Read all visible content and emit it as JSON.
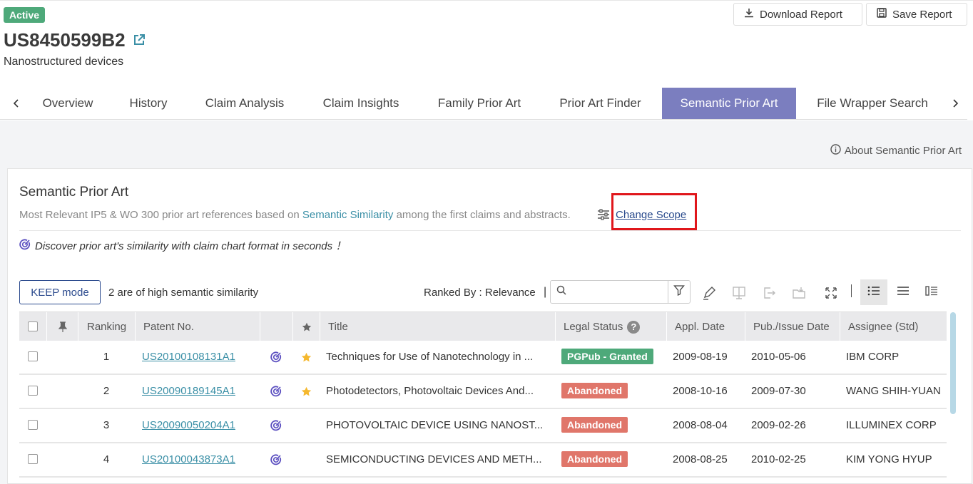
{
  "header": {
    "status": "Active",
    "patent_number": "US8450599B2",
    "subtitle": "Nanostructured devices",
    "download_label": "Download Report",
    "save_label": "Save Report"
  },
  "tabs": [
    {
      "label": "Overview",
      "active": false
    },
    {
      "label": "History",
      "active": false
    },
    {
      "label": "Claim Analysis",
      "active": false
    },
    {
      "label": "Claim Insights",
      "active": false
    },
    {
      "label": "Family Prior Art",
      "active": false
    },
    {
      "label": "Prior Art Finder",
      "active": false
    },
    {
      "label": "Semantic Prior Art",
      "active": true
    },
    {
      "label": "File Wrapper Search",
      "active": false
    }
  ],
  "about_label": "About Semantic Prior Art",
  "card": {
    "title": "Semantic Prior Art",
    "desc_prefix": "Most Relevant IP5 & WO 300 prior art references based on",
    "desc_highlight": "Semantic Similarity",
    "desc_suffix": "among the first claims and abstracts.",
    "change_scope": "Change Scope",
    "discover": "Discover prior art's similarity with claim chart format in seconds ！"
  },
  "toolbar": {
    "keep_mode": "KEEP mode",
    "similarity_note": "2 are of high semantic similarity",
    "ranked_by": "Ranked By : Relevance",
    "separator": "|",
    "search_placeholder": ""
  },
  "table": {
    "headers": {
      "ranking": "Ranking",
      "patent_no": "Patent No.",
      "title": "Title",
      "legal_status": "Legal Status",
      "appl_date": "Appl. Date",
      "pub_date": "Pub./Issue Date",
      "assignee": "Assignee (Std)"
    },
    "rows": [
      {
        "ranking": "1",
        "patent_no": "US20100108131A1",
        "starred": true,
        "title": "Techniques for Use of Nanotechnology in ...",
        "status": "PGPub - Granted",
        "status_type": "granted",
        "appl_date": "2009-08-19",
        "pub_date": "2010-05-06",
        "assignee": "IBM CORP"
      },
      {
        "ranking": "2",
        "patent_no": "US20090189145A1",
        "starred": true,
        "title": "Photodetectors, Photovoltaic Devices And...",
        "status": "Abandoned",
        "status_type": "abandoned",
        "appl_date": "2008-10-16",
        "pub_date": "2009-07-30",
        "assignee": "WANG SHIH-YUAN"
      },
      {
        "ranking": "3",
        "patent_no": "US20090050204A1",
        "starred": false,
        "title": "PHOTOVOLTAIC DEVICE USING NANOST...",
        "status": "Abandoned",
        "status_type": "abandoned",
        "appl_date": "2008-08-04",
        "pub_date": "2009-02-26",
        "assignee": "ILLUMINEX CORP"
      },
      {
        "ranking": "4",
        "patent_no": "US20100043873A1",
        "starred": false,
        "title": "SEMICONDUCTING DEVICES AND METH...",
        "status": "Abandoned",
        "status_type": "abandoned",
        "appl_date": "2008-08-25",
        "pub_date": "2010-02-25",
        "assignee": "KIM YONG HYUP"
      }
    ]
  },
  "icons": {
    "download": "download-icon",
    "save": "save-icon",
    "external": "external-link-icon",
    "info": "info-icon",
    "scope": "sliders-icon",
    "semantic": "semantic-target-icon",
    "star": "star-icon",
    "pin": "pin-icon"
  },
  "colors": {
    "active_badge": "#4ea97a",
    "active_tab": "#7b7ebf",
    "link": "#3a8fa6",
    "abandoned": "#e0766a",
    "granted": "#4ea97a",
    "highlight_box": "#e0161b",
    "semantic_icon": "#5b4fc0",
    "star": "#f5b82e"
  }
}
